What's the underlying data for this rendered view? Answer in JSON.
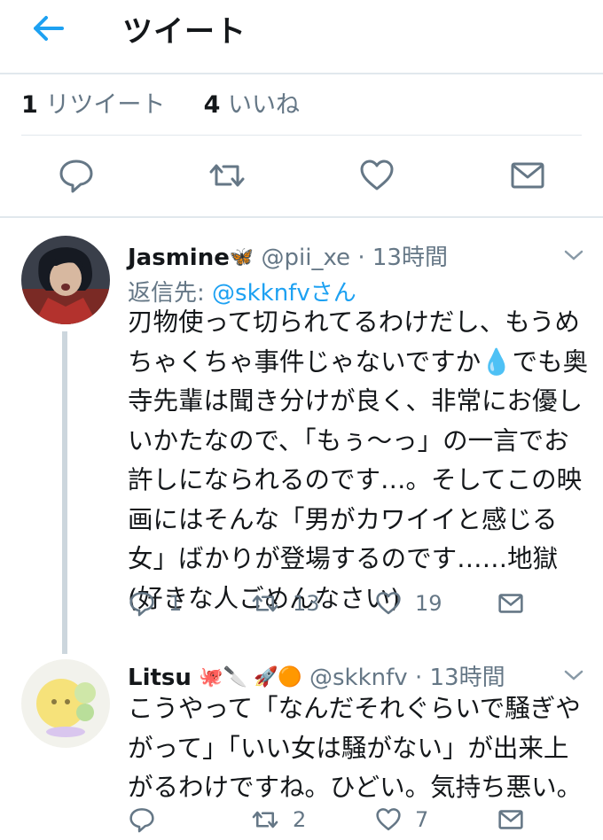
{
  "header": {
    "title": "ツイート",
    "back_icon": "arrow-left-icon"
  },
  "stats": {
    "retweet_count": "1",
    "retweet_label": "リツイート",
    "like_count": "4",
    "like_label": "いいね"
  },
  "actions": [
    "reply-icon",
    "retweet-icon",
    "like-icon",
    "share-icon"
  ],
  "colors": {
    "accent": "#1da1f2",
    "muted": "#657786",
    "divider": "#e1e8ed",
    "thread_line": "#ccd6dd"
  },
  "replies": [
    {
      "name": "Jasmine",
      "name_emoji": "🦋",
      "handle": "@pii_xe",
      "time": "· 13時間",
      "reply_label": "返信先: ",
      "reply_mention": "@skknfvさん",
      "text": "刃物使って切られてるわけだし、もうめちゃくちゃ事件じゃないですか💧でも奥寺先輩は聞き分けが良く、非常にお優しいかたなので、「もぅ〜っ」の一言でお許しになられるのです…。そしてこの映画にはそんな「男がカワイイと感じる女」ばかりが登場するのです……地獄(好きな人ごめんなさい)",
      "reply_count": "1",
      "retweet_count": "13",
      "like_count": "19"
    },
    {
      "name": "Litsu",
      "name_emoji": "🐙🔪 🚀🟠",
      "handle": "@skknfv",
      "time": "· 13時間",
      "text": "こうやって「なんだそれぐらいで騒ぎやがって」「いい女は騒がない」が出来上がるわけですね。ひどい。気持ち悪い。",
      "reply_count": "",
      "retweet_count": "2",
      "like_count": "7"
    }
  ]
}
